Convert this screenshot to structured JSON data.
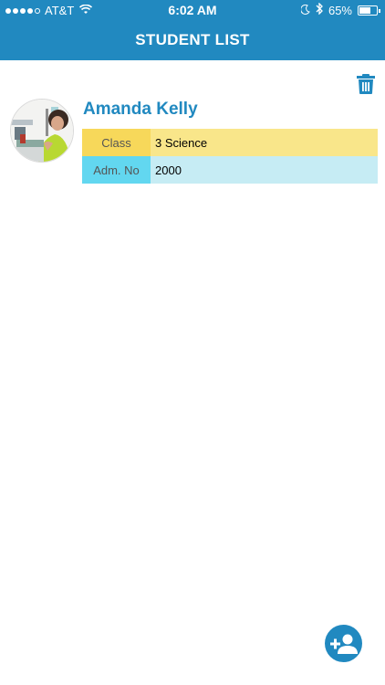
{
  "status_bar": {
    "carrier": "AT&T",
    "time": "6:02 AM",
    "battery_percent": "65%",
    "battery_level": 0.65,
    "signal_bars_filled": 4,
    "signal_bars_total": 5
  },
  "header": {
    "title": "STUDENT LIST",
    "color": "#2189c0"
  },
  "students": [
    {
      "name": "Amanda Kelly",
      "class_label": "Class",
      "class_value": "3 Science",
      "adm_label": "Adm. No",
      "adm_value": "2000"
    }
  ],
  "icons": {
    "delete": "trash-icon",
    "add": "add-person-icon"
  }
}
